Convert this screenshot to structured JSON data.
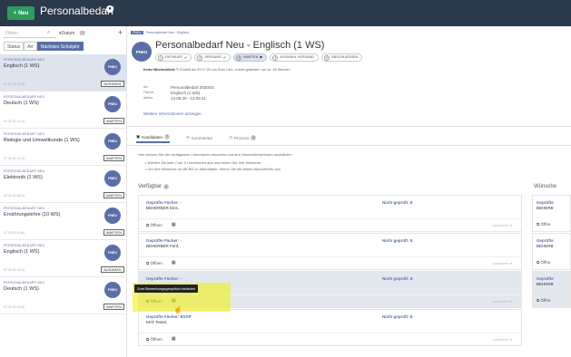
{
  "topbar": {
    "new_label": "Neu",
    "new_icon": "plus-icon",
    "title": "Personalbedarf",
    "badge": "●"
  },
  "sidebar": {
    "filter_placeholder": "Filtern",
    "sort_label": "Datum",
    "segments": [
      "Status",
      "Art",
      "Nächstes Schuljahr"
    ],
    "items": [
      {
        "type": "PERSONALBEDARF NEU",
        "name": "Englisch (1 WS)",
        "avatar": "PNEU",
        "time": "07.07.20 10:09",
        "status": "AUSWAHL"
      },
      {
        "type": "PERSONALBEDARF NEU",
        "name": "Deutsch (1 WS)",
        "avatar": "PNEU",
        "time": "07.06.20 14:41",
        "status": "WARTEN"
      },
      {
        "type": "PERSONALBEDARF NEU",
        "name": "Biologie und Umweltkunde (1 WS)",
        "avatar": "PNEU",
        "time": "07.06.20 11:14",
        "status": "WARTEN"
      },
      {
        "type": "PERSONALBEDARF NEU",
        "name": "Elektronik (1 WS)",
        "avatar": "PNEU",
        "time": "23.05.20 08:22",
        "status": "WARTEN"
      },
      {
        "type": "PERSONALBEDARF NEU",
        "name": "Ernährungslehre (10 WS)",
        "avatar": "PNEU",
        "time": "07.05.20 10:40",
        "status": "WARTEN"
      },
      {
        "type": "PERSONALBEDARF NEU",
        "name": "Englisch (1 WS)",
        "avatar": "PNEU",
        "time": "07.05.20 16:51",
        "status": "AUSWAHL"
      },
      {
        "type": "PERSONALBEDARF NEU",
        "name": "Deutsch (1 WS)",
        "avatar": "PNEU",
        "time": "07.05.20 10:02",
        "status": "WARTEN"
      }
    ]
  },
  "main": {
    "breadcrumb_badge": "PNEU",
    "breadcrumb": "Personalbedarf Neu · Englisch",
    "avatar": "PNEU",
    "title": "Personalbedarf Neu - Englisch (1 WS)",
    "steps": [
      {
        "num": "1",
        "label": "ENTWURF",
        "check": "✔"
      },
      {
        "num": "2",
        "label": "VERSAND",
        "check": "✔"
      },
      {
        "num": "3",
        "label": "WARTEN",
        "check": "▶"
      },
      {
        "num": "4",
        "label": "AUSWAHL VERSAND",
        "check": ""
      },
      {
        "num": "5",
        "label": "ABSCHLIESSEN",
        "check": ""
      }
    ],
    "meta_strong": "Keine Bitcheckliste",
    "meta_rest": "Erstellt am 09.07.20 von Bron Lfee, zuletzt geändert: vor ca. 18 Stunden",
    "meta_rows": [
      {
        "label": "Art",
        "value": "Personalbedarf 2020/21"
      },
      {
        "label": "Fächer",
        "value": "Englisch (1 WS)"
      },
      {
        "label": "ab/bis",
        "value": "14.09.20 - 12.09.21"
      }
    ],
    "more_info": "Weitere Informationen anzeigen",
    "tabs": [
      {
        "label": "Kandidaten",
        "count": "7"
      },
      {
        "label": "Kommentar",
        "count": ""
      },
      {
        "label": "Prozess",
        "count": "3"
      }
    ],
    "info_text": "Hier können Sie die verfügbaren Lehrerinnen einsehen und Ihre Wunschlehrerinnen auswählen:",
    "bullets": [
      "Wählen Sie bitte 1 bis 3 Lehrerinnen aus und reihen Sie Ihre Wünsche.",
      "Um Ihre Wünsche an die BD zu übermitteln, führen Sie die Aktion Abschließen aus."
    ],
    "available_label": "Verfügbar",
    "available_count": "4",
    "wishes_label": "Wünsche",
    "cards": [
      {
        "fach": "Geprüfte Fächer: -",
        "name": "BEHERBER Eins,",
        "not_checked": "Nicht geprüft: E",
        "open": "Öffnen",
        "dropdown": "Auswählen ▾"
      },
      {
        "fach": "Geprüfte Fächer: -",
        "name": "BEHERBER Fünf,",
        "not_checked": "Nicht geprüft: E",
        "open": "Öffnen",
        "dropdown": "Auswählen ▾"
      },
      {
        "fach": "Geprüfte Fächer: -",
        "name": "",
        "not_checked": "Nicht geprüft: E",
        "open": "Öffnen",
        "dropdown": "Auswählen ▾"
      },
      {
        "fach": "Geprüfte Fächer: BSSP",
        "name": "MAT Testel,",
        "not_checked": "Nicht geprüft: E",
        "open": "Öffnen",
        "dropdown": "Auswählen ▾"
      }
    ],
    "right_cards": [
      {
        "fach": "Geprüfte",
        "name": "BEHERB",
        "open": "Öffne"
      },
      {
        "fach": "Geprüfte",
        "name": "BEHERB",
        "open": "Öffne"
      },
      {
        "fach": "Geprüfte",
        "name": "BEHERB",
        "open": "Öffne"
      }
    ],
    "tooltip": "Zum Bewerbungsgespräch einladen"
  }
}
